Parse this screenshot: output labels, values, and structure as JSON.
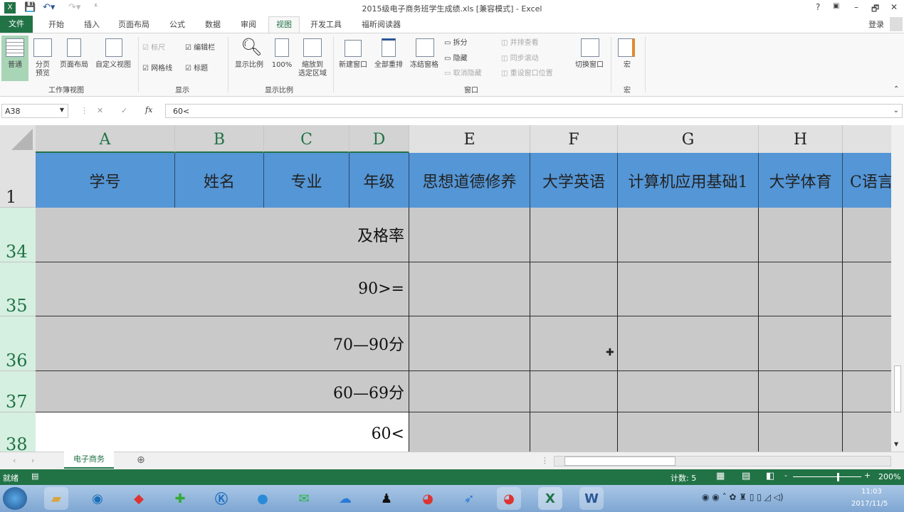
{
  "window": {
    "title": "2015级电子商务班学生成绩.xls  [兼容模式] - Excel",
    "help": "?",
    "minimize": "–",
    "restore": "🗗",
    "close": "✕",
    "signin": "登录"
  },
  "tabs": [
    "文件",
    "开始",
    "插入",
    "页面布局",
    "公式",
    "数据",
    "审阅",
    "视图",
    "开发工具",
    "福昕阅读器"
  ],
  "ribbon": {
    "workbook_views": {
      "label": "工作簿视图",
      "items": [
        "普通",
        "分页\n预览",
        "页面布局",
        "自定义视图"
      ]
    },
    "show": {
      "label": "显示",
      "ruler": "标尺",
      "formula_bar": "编辑栏",
      "gridlines": "网格线",
      "headings": "标题"
    },
    "zoom": {
      "label": "显示比例",
      "items": [
        "显示比例",
        "100%",
        "缩放到\n选定区域"
      ]
    },
    "window": {
      "label": "窗口",
      "new": "新建窗口",
      "arrange": "全部重排",
      "freeze": "冻结窗格",
      "split": "拆分",
      "hide": "隐藏",
      "unhide": "取消隐藏",
      "side": "并排查看",
      "sync": "同步滚动",
      "reset": "重设窗口位置",
      "switch": "切换窗口"
    },
    "macros": {
      "label": "宏",
      "item": "宏"
    }
  },
  "formula": {
    "namebox": "A38",
    "content": "60<"
  },
  "columns": [
    "A",
    "B",
    "C",
    "D",
    "E",
    "F",
    "G",
    "H",
    ""
  ],
  "header_row": {
    "num": "1",
    "cells": [
      "学号",
      "姓名",
      "专业",
      "年级",
      "思想道德修养",
      "大学英语",
      "计算机应用基础1",
      "大学体育",
      "C语言"
    ]
  },
  "rows": [
    {
      "num": "34",
      "label": "及格率"
    },
    {
      "num": "35",
      "label": "90>="
    },
    {
      "num": "36",
      "label": "70—90分"
    },
    {
      "num": "37",
      "label": "60—69分"
    },
    {
      "num": "38",
      "label": "60<"
    }
  ],
  "sheet": {
    "tab": "电子商务",
    "add": "⊕"
  },
  "status": {
    "ready": "就绪",
    "count": "计数: 5",
    "zoom": "200%"
  },
  "taskbar": {
    "time": "11:03",
    "date": "2017/11/5"
  }
}
